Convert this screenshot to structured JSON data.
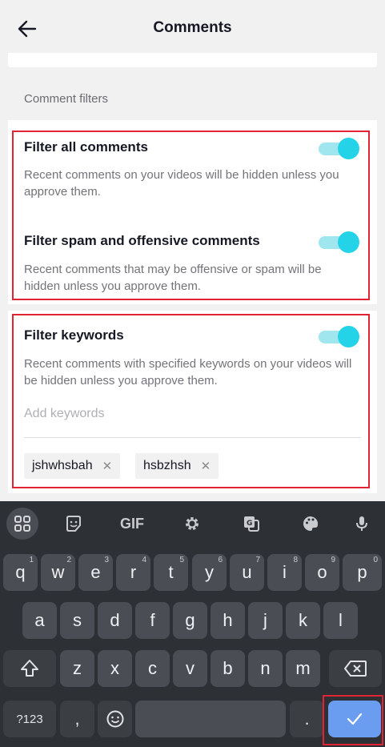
{
  "header": {
    "title": "Comments",
    "back_icon": "arrow-left-icon"
  },
  "section": {
    "label": "Comment filters"
  },
  "filters": [
    {
      "title": "Filter all comments",
      "description": "Recent comments on your videos will be hidden unless you approve them.",
      "enabled": true
    },
    {
      "title": "Filter spam and offensive comments",
      "description": "Recent comments that may be offensive or spam will be hidden unless you approve them.",
      "enabled": true
    },
    {
      "title": "Filter keywords",
      "description": "Recent comments with specified keywords on your videos will be hidden unless you approve them.",
      "enabled": true
    }
  ],
  "keywords": {
    "placeholder": "Add keywords",
    "chips": [
      {
        "label": "jshwhsbah",
        "remove": "✕"
      },
      {
        "label": "hsbzhsh",
        "remove": "✕"
      }
    ]
  },
  "toggle_color": "#25d3e8",
  "keyboard": {
    "toolbar": [
      {
        "name": "apps-grid-icon"
      },
      {
        "name": "sticker-icon"
      },
      {
        "name": "gif-button",
        "label": "GIF"
      },
      {
        "name": "settings-gear-icon"
      },
      {
        "name": "translate-icon"
      },
      {
        "name": "palette-icon"
      },
      {
        "name": "microphone-icon"
      }
    ],
    "row1": [
      [
        "q",
        "1"
      ],
      [
        "w",
        "2"
      ],
      [
        "e",
        "3"
      ],
      [
        "r",
        "4"
      ],
      [
        "t",
        "5"
      ],
      [
        "y",
        "6"
      ],
      [
        "u",
        "7"
      ],
      [
        "i",
        "8"
      ],
      [
        "o",
        "9"
      ],
      [
        "p",
        "0"
      ]
    ],
    "row2": [
      "a",
      "s",
      "d",
      "f",
      "g",
      "h",
      "j",
      "k",
      "l"
    ],
    "row3": [
      "z",
      "x",
      "c",
      "v",
      "b",
      "n",
      "m"
    ],
    "row4": {
      "symbols": "?123",
      "comma": ",",
      "period": "."
    },
    "enter_icon": "checkmark-icon"
  }
}
